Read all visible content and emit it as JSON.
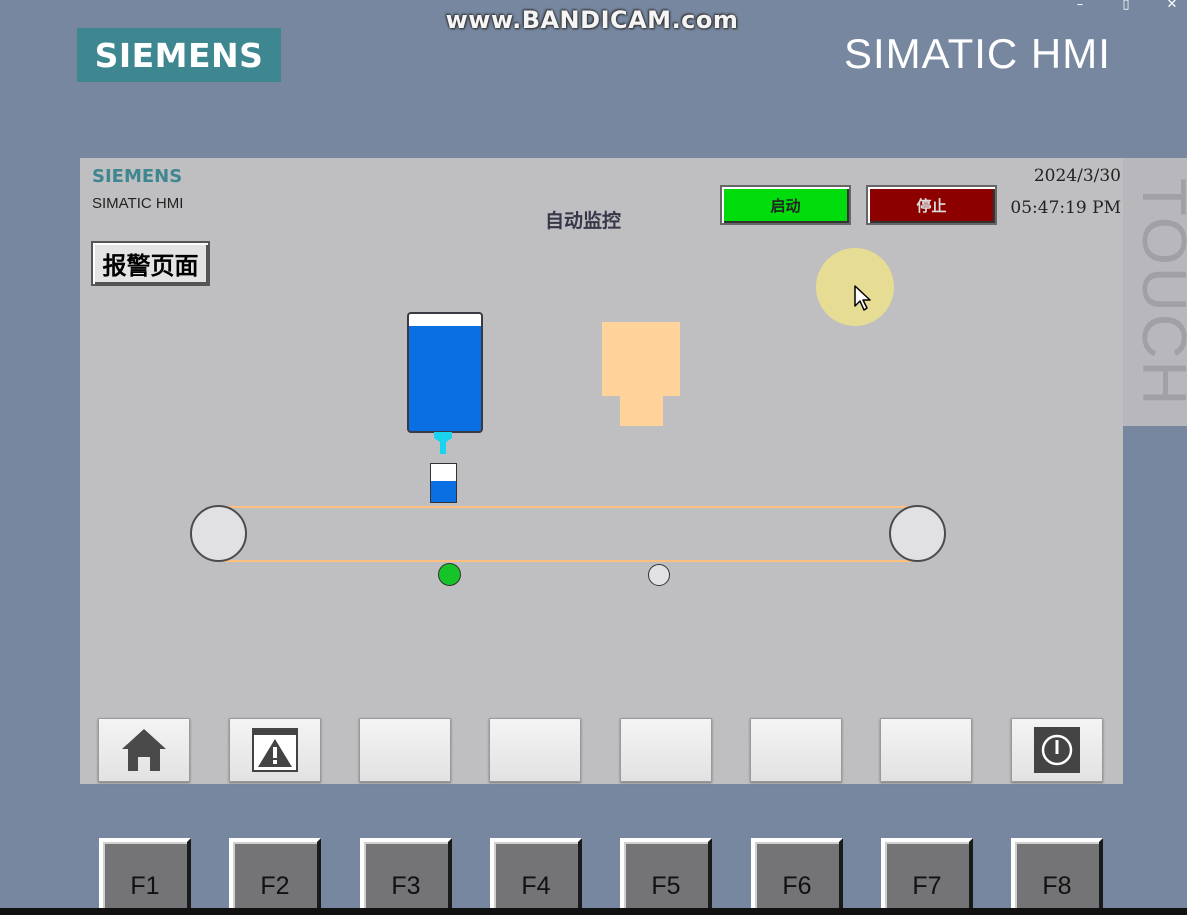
{
  "watermark": "www.BANDICAM.com",
  "device": {
    "brand": "SIEMENS",
    "model": "SIMATIC HMI",
    "side_label": "TOUCH"
  },
  "screen": {
    "logo": "SIEMENS",
    "subtitle": "SIMATIC HMI",
    "title": "自动监控",
    "date": "2024/3/30",
    "time": "05:47:19 PM",
    "start_label": "启动",
    "stop_label": "停止",
    "alarm_page_label": "报警页面"
  },
  "process": {
    "bottle_fill_fraction": 0.55,
    "sensor_1_state": "on",
    "sensor_2_state": "off"
  },
  "nav_buttons": [
    {
      "icon": "home-icon"
    },
    {
      "icon": "alarm-view-icon"
    },
    {
      "icon": ""
    },
    {
      "icon": ""
    },
    {
      "icon": ""
    },
    {
      "icon": ""
    },
    {
      "icon": ""
    },
    {
      "icon": "power-icon"
    }
  ],
  "function_keys": [
    "F1",
    "F2",
    "F3",
    "F4",
    "F5",
    "F6",
    "F7",
    "F8"
  ],
  "colors": {
    "start_green": "#00dc0b",
    "stop_red": "#8d0000",
    "tank_blue": "#0a6fe2",
    "capper_orange": "#ffd39a",
    "sensor_on": "#16c42a",
    "sensor_off": "#e1e1e3",
    "belt": "#ffbf80"
  }
}
